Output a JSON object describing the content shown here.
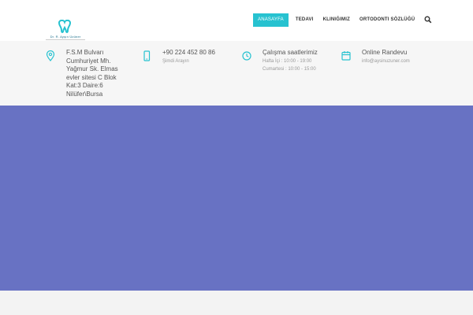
{
  "logo": {
    "text": "Dr. R. Ayşın Üzüner"
  },
  "nav": {
    "items": [
      {
        "label": "ANASAYFA",
        "active": true
      },
      {
        "label": "TEDAVI",
        "active": false
      },
      {
        "label": "KLINIĞIMIZ",
        "active": false
      },
      {
        "label": "ORTODONTI SÖZLÜĞÜ",
        "active": false
      }
    ],
    "search_icon": "search-icon"
  },
  "info": {
    "address": {
      "icon": "map-pin-icon",
      "lines": [
        "F.S.M Bulvarı",
        "Cumhuriyet Mh.",
        "Yağmur Sk. Elmas",
        "evler sitesi C Blok",
        "Kat:3 Daire:6",
        "Nilüfer\\Bursa"
      ]
    },
    "phone": {
      "icon": "mobile-phone-icon",
      "title": "+90 224 452 80 86",
      "sub": "Şimdi Arayın"
    },
    "hours": {
      "icon": "clock-icon",
      "title": "Çalışma saatlerimiz",
      "lines": [
        "Hafta İçi : 10:00 - 19:00",
        "Cumartesi : 10:00 - 15:00"
      ]
    },
    "appointment": {
      "icon": "calendar-icon",
      "title": "Online Randevu",
      "sub": "info@aysinuzuner.com"
    }
  },
  "colors": {
    "accent": "#27c2d0",
    "banner": "#6872c3",
    "infobar": "#f6f6f6"
  }
}
